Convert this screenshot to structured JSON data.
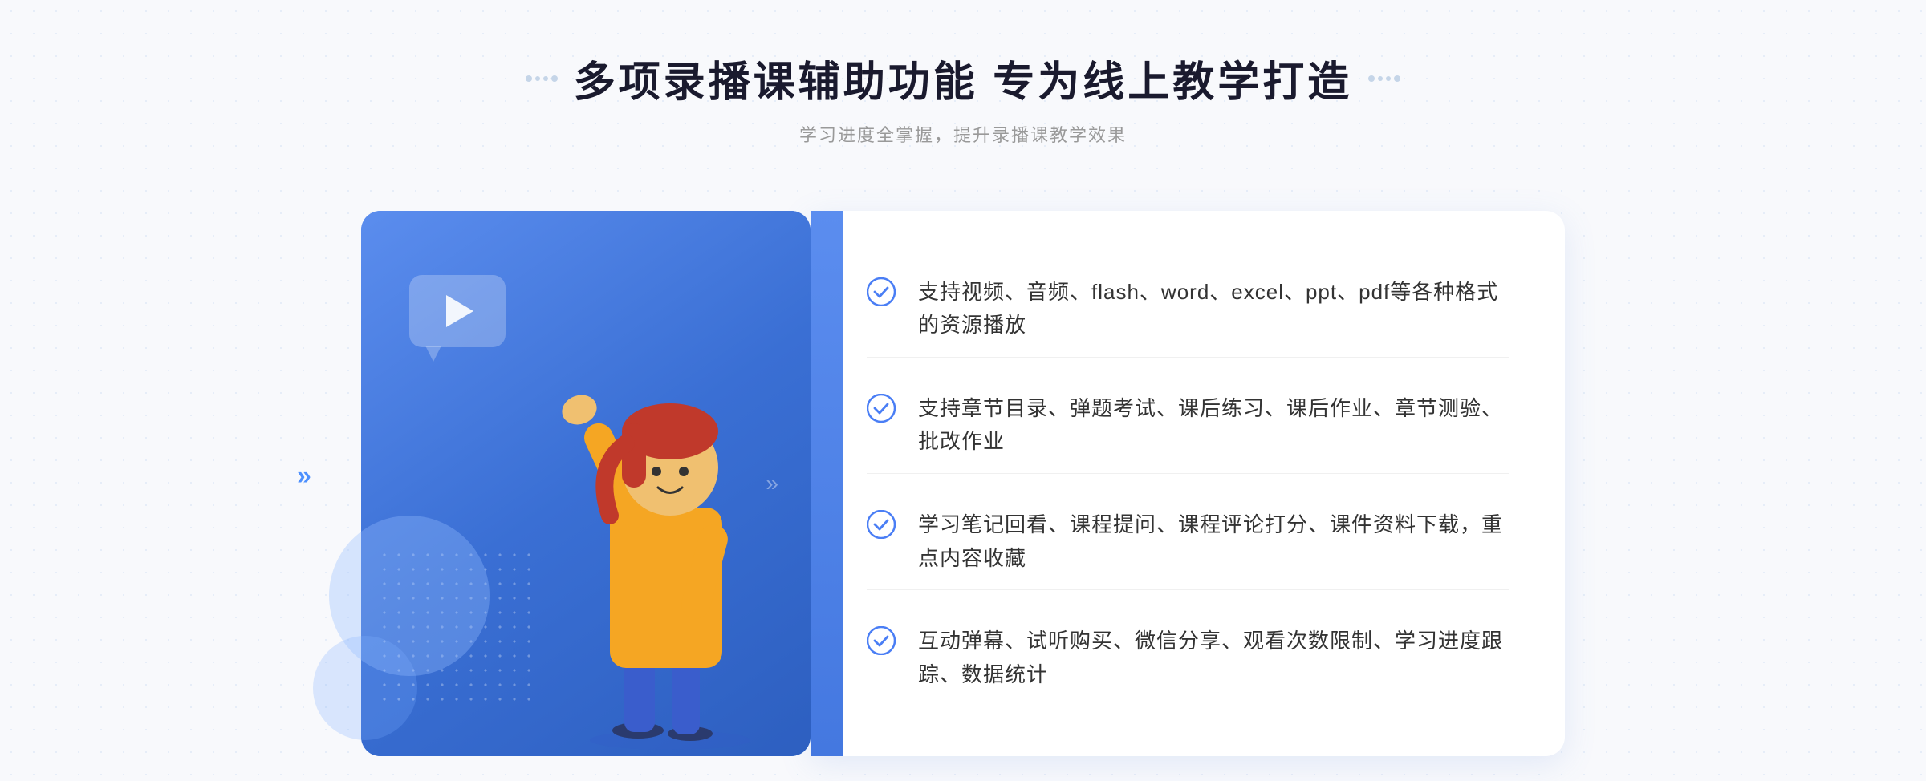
{
  "header": {
    "title": "多项录播课辅助功能 专为线上教学打造",
    "subtitle": "学习进度全掌握，提升录播课教学效果",
    "decorative_dots_left": "⁘",
    "decorative_dots_right": "⁘"
  },
  "features": [
    {
      "id": 1,
      "text": "支持视频、音频、flash、word、excel、ppt、pdf等各种格式的资源播放"
    },
    {
      "id": 2,
      "text": "支持章节目录、弹题考试、课后练习、课后作业、章节测验、批改作业"
    },
    {
      "id": 3,
      "text": "学习笔记回看、课程提问、课程评论打分、课件资料下载，重点内容收藏"
    },
    {
      "id": 4,
      "text": "互动弹幕、试听购买、微信分享、观看次数限制、学习进度跟踪、数据统计"
    }
  ],
  "colors": {
    "primary_blue": "#4a7ef5",
    "gradient_start": "#5b8dee",
    "gradient_end": "#3d6fd8",
    "text_dark": "#1a1a2e",
    "text_gray": "#999999",
    "check_color": "#4a7ef5",
    "white": "#ffffff"
  }
}
